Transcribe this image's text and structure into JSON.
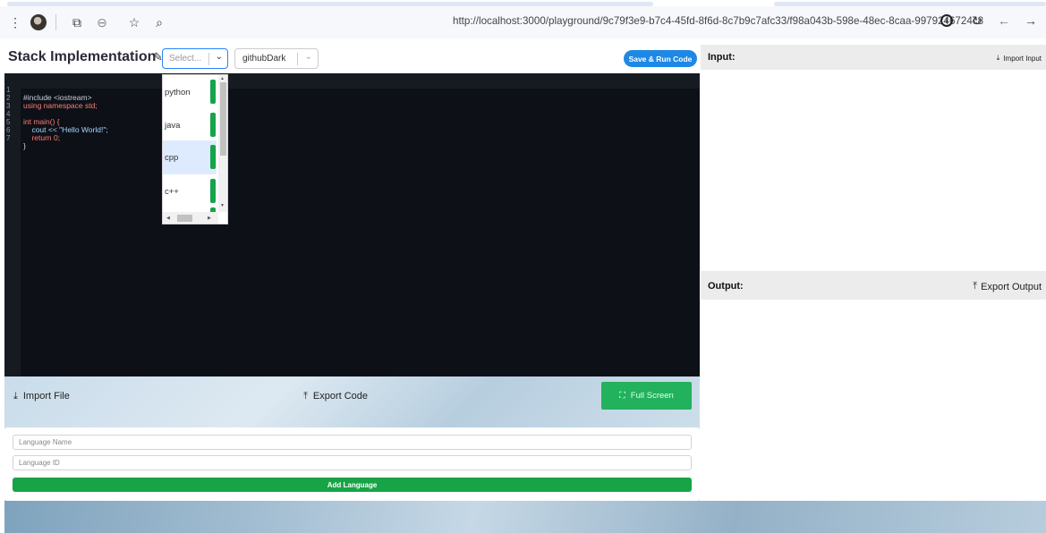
{
  "browser": {
    "url": "http://localhost:3000/playground/9c79f3e9-b7c4-45fd-8f6d-8c7b9c7afc33/f98a043b-598e-48ec-8caa-9979246724c8",
    "icons": [
      "more-vert-icon",
      "profile-avatar",
      "extensions-icon",
      "sparkle-icon",
      "star-icon",
      "search-icon",
      "info-icon",
      "reload-icon",
      "back-icon",
      "forward-icon"
    ]
  },
  "header": {
    "title": "Stack Implementation",
    "language_placeholder": "Select...",
    "theme_value": "githubDark",
    "run_label": "Save & Run Code"
  },
  "dropdown": {
    "options": [
      {
        "label": "python",
        "selected": false
      },
      {
        "label": "java",
        "selected": false
      },
      {
        "label": "cpp",
        "selected": true
      },
      {
        "label": "c++",
        "selected": false
      }
    ],
    "accent": "#16a34a"
  },
  "editor": {
    "lines": [
      {
        "n": "1",
        "text": "#include <iostream>"
      },
      {
        "n": "2",
        "text": "using namespace std;"
      },
      {
        "n": "3",
        "text": ""
      },
      {
        "n": "4",
        "text": "int main() {"
      },
      {
        "n": "5",
        "text": "    cout << \"Hello World!\";"
      },
      {
        "n": "6",
        "text": "    return 0;"
      },
      {
        "n": "7",
        "text": "}"
      }
    ],
    "background": "#0d1117"
  },
  "actions": {
    "import_file": "Import File",
    "export_code": "Export Code",
    "full_screen": "Full Screen"
  },
  "language_form": {
    "name_placeholder": "Language Name",
    "id_placeholder": "Language ID",
    "add_label": "Add Language",
    "add_color": "#17a447"
  },
  "input_panel": {
    "title": "Input:",
    "import_label": "Import Input"
  },
  "output_panel": {
    "title": "Output:",
    "export_label": "Export Output"
  }
}
